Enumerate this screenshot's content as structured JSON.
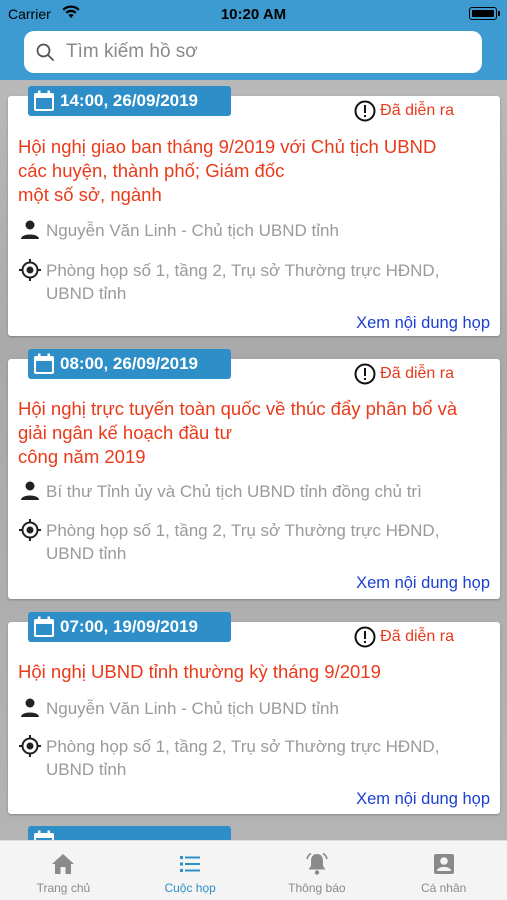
{
  "status_bar": {
    "carrier": "Carrier",
    "time": "10:20 AM"
  },
  "search": {
    "placeholder": "Tìm kiếm hồ sơ"
  },
  "meetings": [
    {
      "datetime": "14:00, 26/09/2019",
      "status": "Đã diễn ra",
      "title_lines": [
        "Hội nghị giao ban tháng 9/2019 với Chủ tịch UBND",
        "các huyện, thành phố; Giám đốc",
        "một số sở, ngành"
      ],
      "chair": "Nguyễn Văn Linh - Chủ tịch UBND tỉnh",
      "location_lines": [
        "Phòng họp số 1, tầng 2, Trụ sở Thường trực HĐND,",
        "UBND tỉnh"
      ],
      "link": "Xem nội dung họp"
    },
    {
      "datetime": "08:00, 26/09/2019",
      "status": "Đã diễn ra",
      "title_lines": [
        "Hội nghị trực tuyến toàn quốc về thúc đẩy phân bổ và",
        "giải ngân kế hoạch đầu tư",
        "công năm 2019"
      ],
      "chair": "Bí thư Tỉnh ủy và Chủ tịch UBND tỉnh đồng chủ trì",
      "location_lines": [
        "Phòng họp số 1, tầng 2, Trụ sở Thường trực HĐND,",
        "UBND tỉnh"
      ],
      "link": "Xem nội dung họp"
    },
    {
      "datetime": "07:00, 19/09/2019",
      "status": "Đã diễn ra",
      "title_lines": [
        "Hội nghị UBND tỉnh thường kỳ tháng 9/2019"
      ],
      "chair": "Nguyễn Văn Linh - Chủ tịch UBND tỉnh",
      "location_lines": [
        "Phòng họp số 1, tầng 2, Trụ sở Thường trực HĐND,",
        "UBND tỉnh"
      ],
      "link": "Xem nội dung họp"
    }
  ],
  "tabs": [
    {
      "label": "Trang chủ",
      "icon": "home-icon"
    },
    {
      "label": "Cuộc họp",
      "icon": "list-icon",
      "active": true
    },
    {
      "label": "Thông báo",
      "icon": "bell-icon"
    },
    {
      "label": "Cá nhân",
      "icon": "profile-icon"
    }
  ],
  "colors": {
    "accent": "#2e8fc8",
    "status": "#e53a1b",
    "link": "#1a3fd1"
  }
}
